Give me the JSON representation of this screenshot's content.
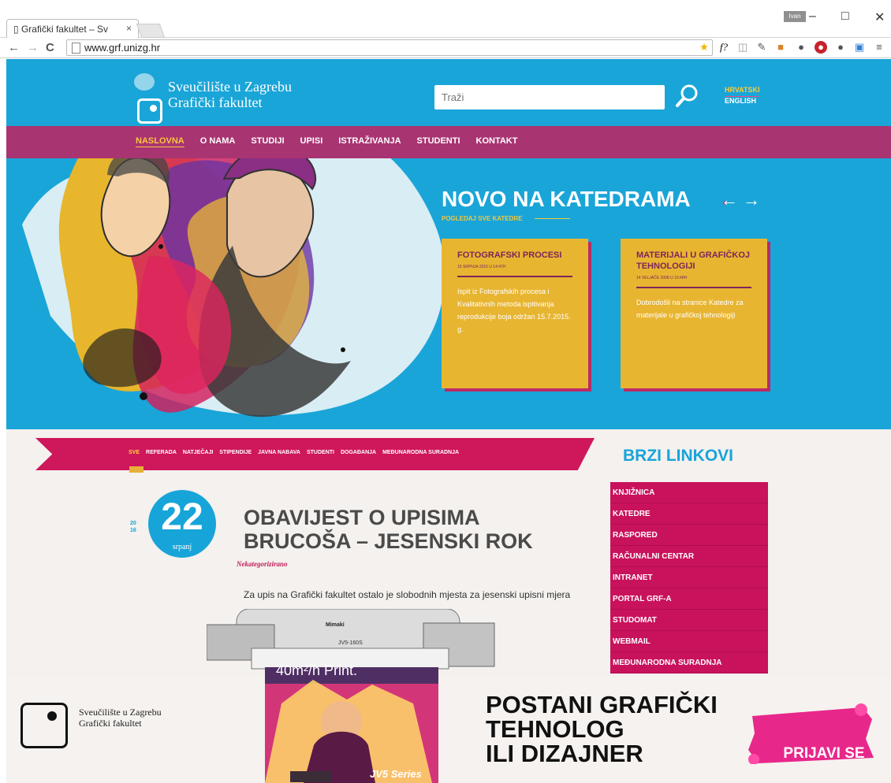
{
  "browser": {
    "tab_title": "Grafički fakultet – Sv",
    "url": "www.grf.unizg.hr",
    "user_badge": "Ivan",
    "window_buttons": [
      "–",
      "□",
      "✕"
    ],
    "nav": {
      "back": "←",
      "forward": "→",
      "reload": "C"
    }
  },
  "header": {
    "brand_line1": "Sveučilište u Zagrebu",
    "brand_line2": "Grafički fakultet",
    "search_placeholder": "Traži",
    "languages": [
      "HRVATSKI",
      "ENGLISH"
    ],
    "menu": [
      "NASLOVNA",
      "O NAMA",
      "STUDIJI",
      "UPISI",
      "ISTRAŽIVANJA",
      "STUDENTI",
      "KONTAKT"
    ]
  },
  "hero": {
    "title": "NOVO NA KATEDRAMA",
    "link": "POGLEDAJ SVE KATEDRE",
    "cards": [
      {
        "title": "FOTOGRAFSKI PROCESI",
        "date": "15 SRPNJA 2015 U 14:47H",
        "text": "Ispit iz Fotografskih procesa i Kvalitativnih metoda ispitivanja reprodukcije boja održan 15.7.2015. g."
      },
      {
        "title": "MATERIJALI U GRAFIČKOJ TEHNOLOGIJI",
        "date": "14 VELJAČE 2008 U 10:48H",
        "text": "Dobrodošli na stranice Katedre za materijale u grafičkoj tehnologiji"
      }
    ]
  },
  "filters": [
    "SVE",
    "REFERADA",
    "NATJEČAJI",
    "STIPENDIJE",
    "JAVNA NABAVA",
    "STUDENTI",
    "DOGAĐANJA",
    "MEĐUNARODNA SURADNJA"
  ],
  "post": {
    "year": "20\n16",
    "day": "22",
    "month": "srpanj",
    "title": "OBAVIJEST O UPISIMA BRUCOŠA – JESENSKI ROK",
    "category": "Nekategorizirano",
    "text": "Za upis na Grafički fakultet ostalo je slobodnih mjesta za jesenski upisni mjera kao što je definirano u prvoj obavijesti i aplikaciji"
  },
  "quick_links": {
    "title": "BRZI LINKOVI",
    "items": [
      "KNJIŽNICA",
      "KATEDRE",
      "RASPORED",
      "RAČUNALNI CENTAR",
      "INTRANET",
      "PORTAL GRF-A",
      "STUDOMAT",
      "WEBMAIL",
      "MEĐUNARODNA SURADNJA"
    ]
  },
  "banner": {
    "brand_line1": "Sveučilište u Zagrebu",
    "brand_line2": "Grafički fakultet",
    "line1": "POSTANI GRAFIČKI",
    "line2": "TEHNOLOG",
    "line3": "ILI DIZAJNER",
    "cta": "PRIJAVI SE",
    "printer_label": "40m²/h Print.",
    "printer_brand": "Mimaki",
    "printer_model": "JV5-160S",
    "printer_series": "JV5 Series"
  },
  "colors": {
    "hero_blue": "#1aa5d8",
    "menu_magenta": "#a93472",
    "filter_pink": "#cf175b",
    "yellow": "#e8b531"
  }
}
